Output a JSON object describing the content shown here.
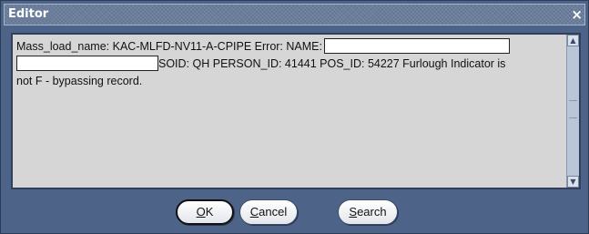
{
  "window": {
    "title": "Editor",
    "close_glyph": "×"
  },
  "editor": {
    "line1_text": "Mass_load_name: KAC-MLFD-NV11-A-CPIPE Error:  NAME:",
    "line2_text": "SOID: QH PERSON_ID: 41441 POS_ID: 54227 Furlough Indicator is",
    "line3_text": "not F - bypassing record."
  },
  "buttons": {
    "ok": {
      "mnemonic": "O",
      "rest": "K"
    },
    "cancel": {
      "mnemonic": "C",
      "rest": "ancel"
    },
    "search": {
      "mnemonic": "S",
      "rest": "earch"
    }
  },
  "icons": {
    "close": "close-icon",
    "scroll_up": "scroll-up-arrow-icon",
    "scroll_down": "scroll-down-arrow-icon"
  }
}
